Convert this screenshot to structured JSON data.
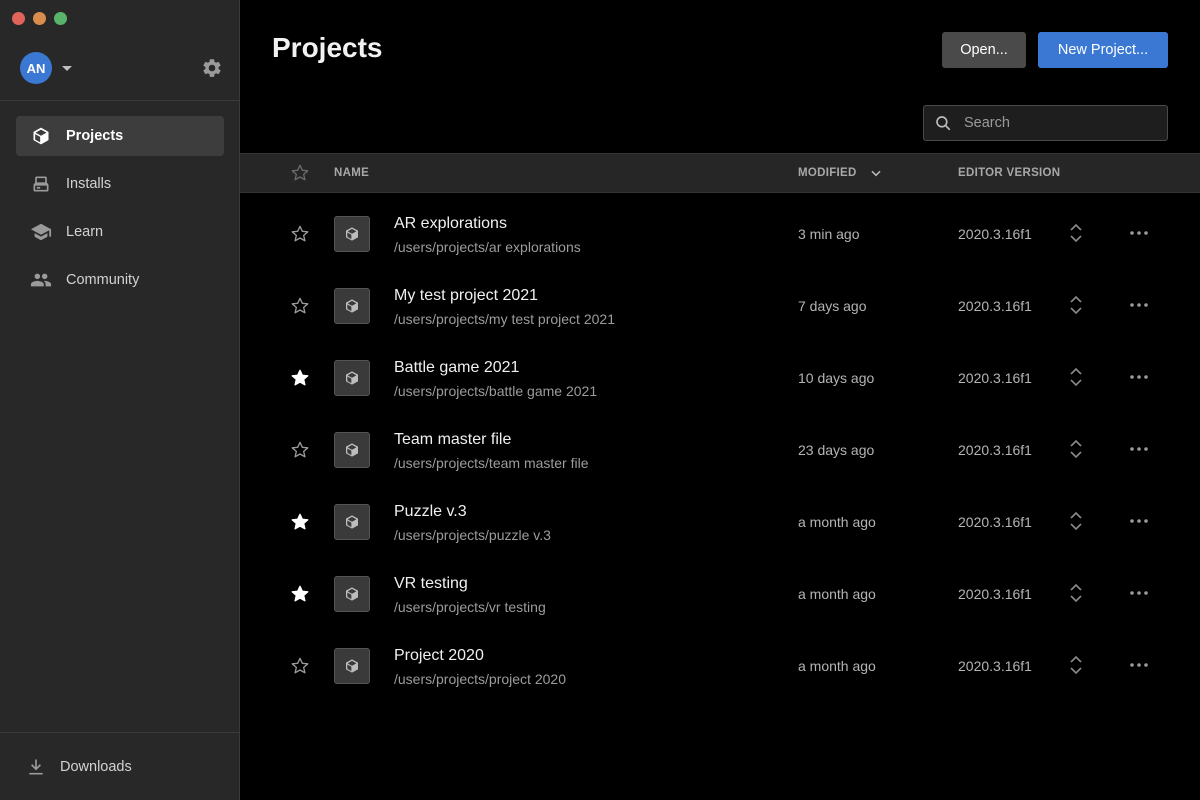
{
  "window": {
    "controls": [
      "close",
      "minimize",
      "maximize"
    ]
  },
  "colors": {
    "accent": "#3a78d4",
    "close": "#e0645a",
    "minimize": "#d98c4b",
    "maximize": "#5ab36a",
    "star_filled": "#ffffff",
    "star_empty": "#9a9a9a"
  },
  "user": {
    "initials": "AN"
  },
  "sidebar": {
    "items": [
      {
        "label": "Projects",
        "icon": "cube-icon",
        "active": true
      },
      {
        "label": "Installs",
        "icon": "drive-icon",
        "active": false
      },
      {
        "label": "Learn",
        "icon": "graduation-cap-icon",
        "active": false
      },
      {
        "label": "Community",
        "icon": "people-icon",
        "active": false
      }
    ],
    "footer": {
      "label": "Downloads",
      "icon": "download-icon"
    }
  },
  "header": {
    "title": "Projects",
    "open_label": "Open...",
    "new_project_label": "New Project..."
  },
  "search": {
    "placeholder": "Search",
    "value": ""
  },
  "table": {
    "columns": {
      "name": "NAME",
      "modified": "MODIFIED",
      "editor_version": "EDITOR VERSION"
    },
    "sort": {
      "column": "modified",
      "direction": "descending"
    },
    "rows": [
      {
        "name": "AR explorations",
        "path": "/users/projects/ar explorations",
        "modified": "3 min ago",
        "version": "2020.3.16f1",
        "starred": false
      },
      {
        "name": "My test project 2021",
        "path": "/users/projects/my test project 2021",
        "modified": "7 days ago",
        "version": "2020.3.16f1",
        "starred": false
      },
      {
        "name": "Battle game 2021",
        "path": "/users/projects/battle game 2021",
        "modified": "10 days ago",
        "version": "2020.3.16f1",
        "starred": true
      },
      {
        "name": "Team master file",
        "path": "/users/projects/team master file",
        "modified": "23 days ago",
        "version": "2020.3.16f1",
        "starred": false
      },
      {
        "name": "Puzzle v.3",
        "path": "/users/projects/puzzle v.3",
        "modified": "a month ago",
        "version": "2020.3.16f1",
        "starred": true
      },
      {
        "name": "VR testing",
        "path": "/users/projects/vr testing",
        "modified": "a month ago",
        "version": "2020.3.16f1",
        "starred": true
      },
      {
        "name": "Project 2020",
        "path": "/users/projects/project 2020",
        "modified": "a month ago",
        "version": "2020.3.16f1",
        "starred": false
      }
    ]
  }
}
